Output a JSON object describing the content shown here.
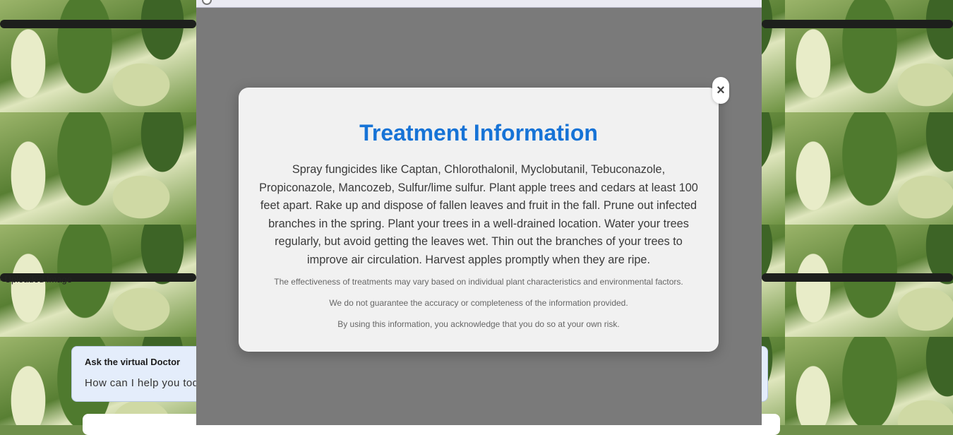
{
  "background": {
    "broken_image_alt": "Uploaded Image"
  },
  "chat": {
    "title": "Ask the virtual Doctor",
    "message": "How can I help you toda"
  },
  "modal": {
    "title": "Treatment Information",
    "body": "Spray fungicides like Captan, Chlorothalonil, Myclobutanil, Tebuconazole, Propiconazole, Mancozeb, Sulfur/lime sulfur. Plant apple trees and cedars at least 100 feet apart. Rake up and dispose of fallen leaves and fruit in the fall. Prune out infected branches in the spring. Plant your trees in a well-drained location. Water your trees regularly, but avoid getting the leaves wet. Thin out the branches of your trees to improve air circulation. Harvest apples promptly when they are ripe.",
    "disclaimers": [
      "The effectiveness of treatments may vary based on individual plant characteristics and environmental factors.",
      "We do not guarantee the accuracy or completeness of the information provided.",
      "By using this information, you acknowledge that you do so at your own risk."
    ],
    "close_icon": "×"
  },
  "colors": {
    "title": "#1673d6",
    "overlay": "#7a7a7a",
    "modal_bg": "#f1f1f1"
  }
}
